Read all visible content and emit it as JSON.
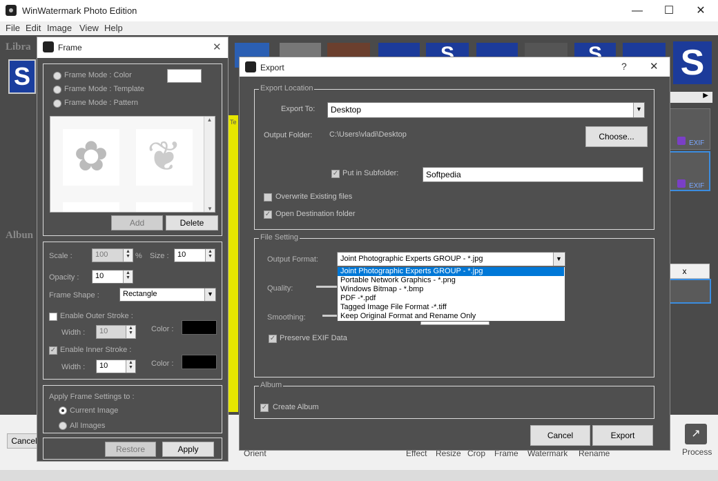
{
  "app": {
    "title": "WinWatermark Photo Edition"
  },
  "menu": [
    "File",
    "Edit",
    "Image",
    "View",
    "Help"
  ],
  "sidebar_labels": {
    "library": "Libra",
    "album": "Albun"
  },
  "right_panel": {
    "exif1": "EXIF",
    "exif2": "EXIF",
    "close_x": "x",
    "ribbon_tag": "Te"
  },
  "bottom": {
    "cancel": "Cancel",
    "tools": [
      "Orient",
      "Effect",
      "Resize",
      "Crop",
      "Frame",
      "Watermark",
      "Rename"
    ],
    "process": "Process"
  },
  "frame": {
    "title": "Frame",
    "modes": [
      "Frame Mode : Color",
      "Frame Mode : Template",
      "Frame Mode : Pattern"
    ],
    "add": "Add",
    "delete": "Delete",
    "scale_label": "Scale :",
    "scale_value": "100",
    "percent": "%",
    "size_label": "Size :",
    "size_value": "10",
    "opacity_label": "Opacity :",
    "opacity_value": "10",
    "shape_label": "Frame Shape :",
    "shape_value": "Rectangle",
    "outer_stroke": "Enable Outer Stroke :",
    "outer_width_label": "Width :",
    "outer_width_value": "10",
    "outer_color_label": "Color :",
    "inner_stroke": "Enable Inner Stroke :",
    "inner_width_label": "Width :",
    "inner_width_value": "10",
    "inner_color_label": "Color :",
    "apply_to_label": "Apply Frame Settings to :",
    "current_image": "Current Image",
    "all_images": "All Images",
    "restore": "Restore",
    "apply": "Apply",
    "frame_color": "#ffffff",
    "outer_color": "#000000",
    "inner_color": "#000000"
  },
  "export": {
    "title": "Export",
    "help": "?",
    "close": "✕",
    "location_group": "Export Location",
    "export_to_label": "Export To:",
    "export_to_value": "Desktop",
    "output_folder_label": "Output Folder:",
    "output_folder_value": "C:\\Users\\vladi\\Desktop",
    "choose": "Choose...",
    "subfolder_label": "Put in Subfolder:",
    "subfolder_value": "Softpedia",
    "overwrite": "Overwrite Existing files",
    "open_dest": "Open Destination folder",
    "file_group": "File Setting",
    "output_format_label": "Output Format:",
    "output_format_value": "Joint Photographic Experts GROUP - *.jpg",
    "format_options": [
      "Joint Photographic Experts GROUP - *.jpg",
      "Portable Network Graphics - *.png",
      "Windows Bitmap - *.bmp",
      "PDF -*.pdf",
      "Tagged Image File Format -*.tiff",
      "Keep Original Format and Rename Only"
    ],
    "quality_label": "Quality:",
    "smoothing_label": "Smoothing:",
    "preserve_exif": "Preserve EXIF Data",
    "album_group": "Album",
    "create_album": "Create Album",
    "cancel": "Cancel",
    "export": "Export"
  }
}
